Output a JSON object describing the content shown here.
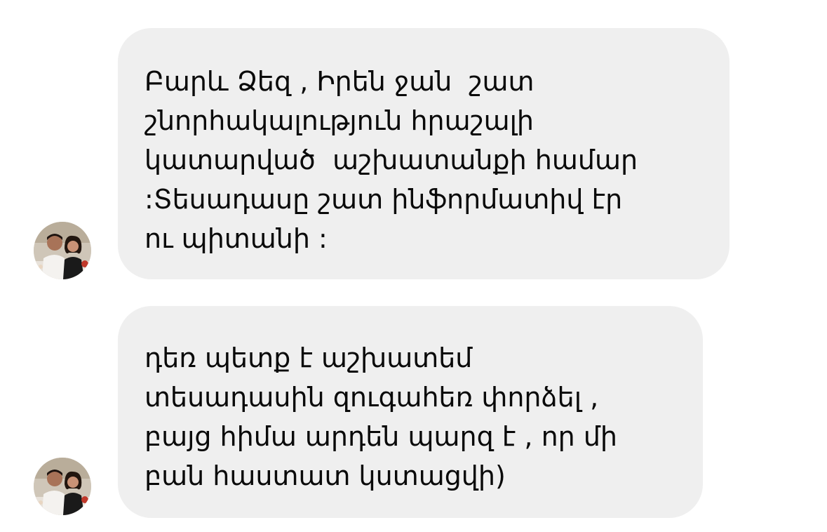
{
  "messages": [
    {
      "sender": "contact",
      "lines": [
        "Բարև Ձեզ , Իրեն ջան  շատ",
        "շնորհակալություն հրաշալի",
        "կատարված  աշխատանքի համար",
        ":Տեսադասը շատ ինֆորմատիվ էր",
        "ու պիտանի :"
      ]
    },
    {
      "sender": "contact",
      "lines": [
        "դեռ պետք է աշխատեմ",
        "տեսադասին զուգահեռ փորձել ,",
        "բայց հիմա արդեն պարզ է , որ մի",
        "բան հաստատ կստացվի)"
      ]
    }
  ],
  "colors": {
    "bubble_bg": "#efefef",
    "text": "#0a0a0a",
    "page_bg": "#ffffff"
  },
  "icons": {
    "avatar": "contact-avatar-photo"
  }
}
